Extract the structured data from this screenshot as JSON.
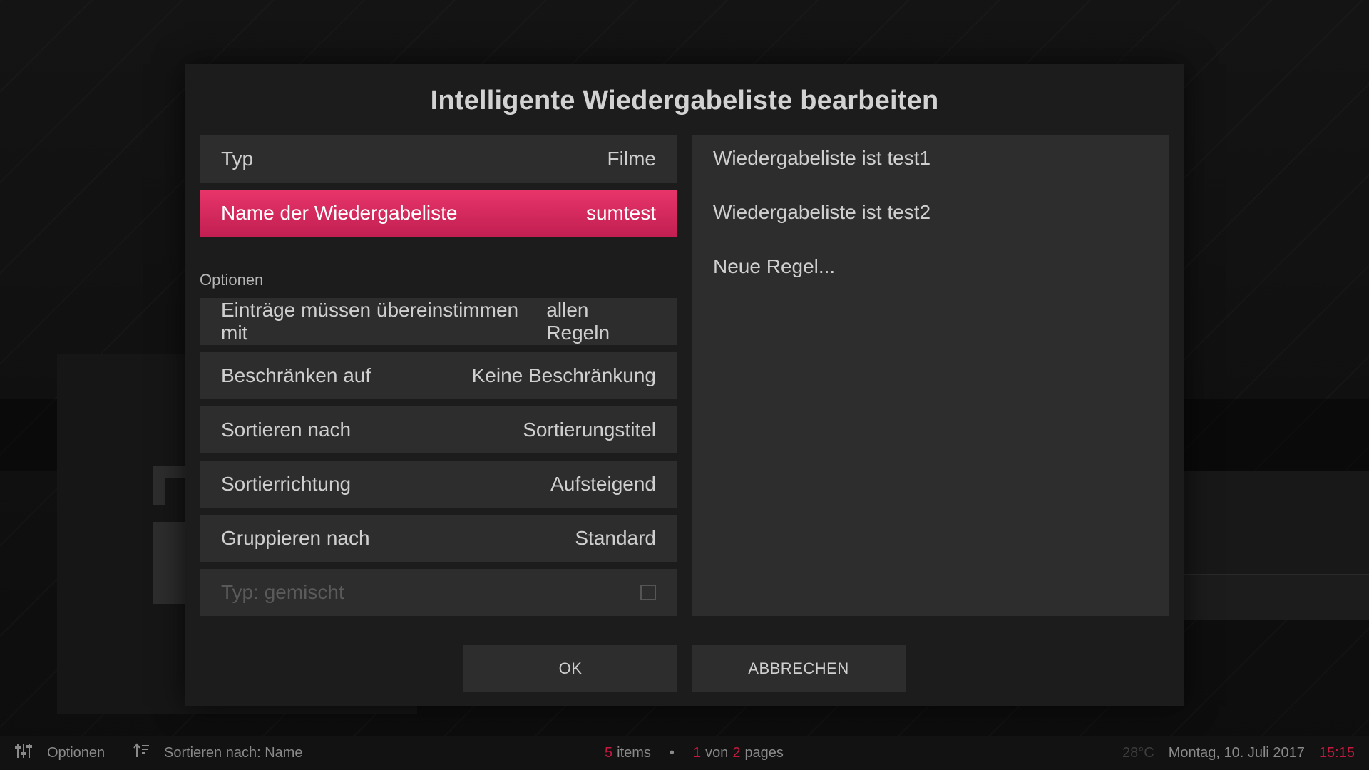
{
  "dialog": {
    "title": "Intelligente Wiedergabeliste bearbeiten",
    "type_row": {
      "label": "Typ",
      "value": "Filme"
    },
    "name_row": {
      "label": "Name der Wiedergabeliste",
      "value": "sumtest"
    },
    "options_label": "Optionen",
    "options": [
      {
        "label": "Einträge müssen übereinstimmen mit",
        "value": "allen Regeln"
      },
      {
        "label": "Beschränken auf",
        "value": "Keine Beschränkung"
      },
      {
        "label": "Sortieren nach",
        "value": "Sortierungstitel"
      },
      {
        "label": "Sortierrichtung",
        "value": "Aufsteigend"
      },
      {
        "label": "Gruppieren nach",
        "value": "Standard"
      }
    ],
    "mixed_row": {
      "label": "Typ: gemischt",
      "checked": false
    },
    "rules": [
      "Wiedergabeliste ist test1",
      "Wiedergabeliste ist test2",
      "Neue Regel..."
    ],
    "ok_label": "OK",
    "cancel_label": "ABBRECHEN"
  },
  "footer": {
    "options_label": "Optionen",
    "sort_label": "Sortieren nach: Name",
    "items_count": "5",
    "items_word": "items",
    "bullet": "•",
    "page_current": "1",
    "page_von": "von",
    "page_total": "2",
    "pages_word": "pages",
    "temperature": "28°C",
    "date": "Montag, 10. Juli 2017",
    "time": "15:15"
  },
  "colors": {
    "accent": "#e0305f",
    "panel": "#2d2d2d",
    "dialog": "#1c1c1c"
  }
}
